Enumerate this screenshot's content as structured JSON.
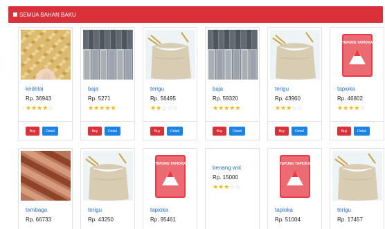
{
  "header": {
    "title": "SEMUA BAHAN BAKU"
  },
  "buttons": {
    "buy": "Buy",
    "detail": "Detail"
  },
  "products_row1": [
    {
      "name": "kedelai",
      "price": "Rp. 36943",
      "rating": 4,
      "image": "kedelai"
    },
    {
      "name": "baja",
      "price": "Rp. 5271",
      "rating": 5,
      "image": "baja"
    },
    {
      "name": "terigu",
      "price": "Rp. 56495",
      "rating": 2,
      "image": "terigu"
    },
    {
      "name": "baja",
      "price": "Rp. 59320",
      "rating": 5,
      "image": "baja"
    },
    {
      "name": "terigu",
      "price": "Rp. 43960",
      "rating": 3,
      "image": "terigu"
    },
    {
      "name": "tapioka",
      "price": "Rp. 46802",
      "rating": 4,
      "image": "tapioka"
    }
  ],
  "products_row2": [
    {
      "name": "tembaga",
      "price": "Rp. 66733",
      "image": "tembaga"
    },
    {
      "name": "terigu",
      "price": "Rp. 43250",
      "image": "terigu"
    },
    {
      "name": "tapioka",
      "price": "Rp. 95461",
      "image": "tapioka"
    },
    {
      "name": "benang wol",
      "price": "Rp. 15000",
      "rating": 3,
      "image": "none"
    },
    {
      "name": "tapioka",
      "price": "Rp. 51004",
      "image": "tapioka"
    },
    {
      "name": "terigu",
      "price": "Rp. 17457",
      "image": "terigu"
    }
  ],
  "tapioka_label": "TEPUNG TAPIOKA",
  "colors": {
    "header": "#d9303a",
    "buy": "#d9303a",
    "detail": "#1b82e6",
    "link": "#2a72c6",
    "star": "#f1b71c"
  }
}
